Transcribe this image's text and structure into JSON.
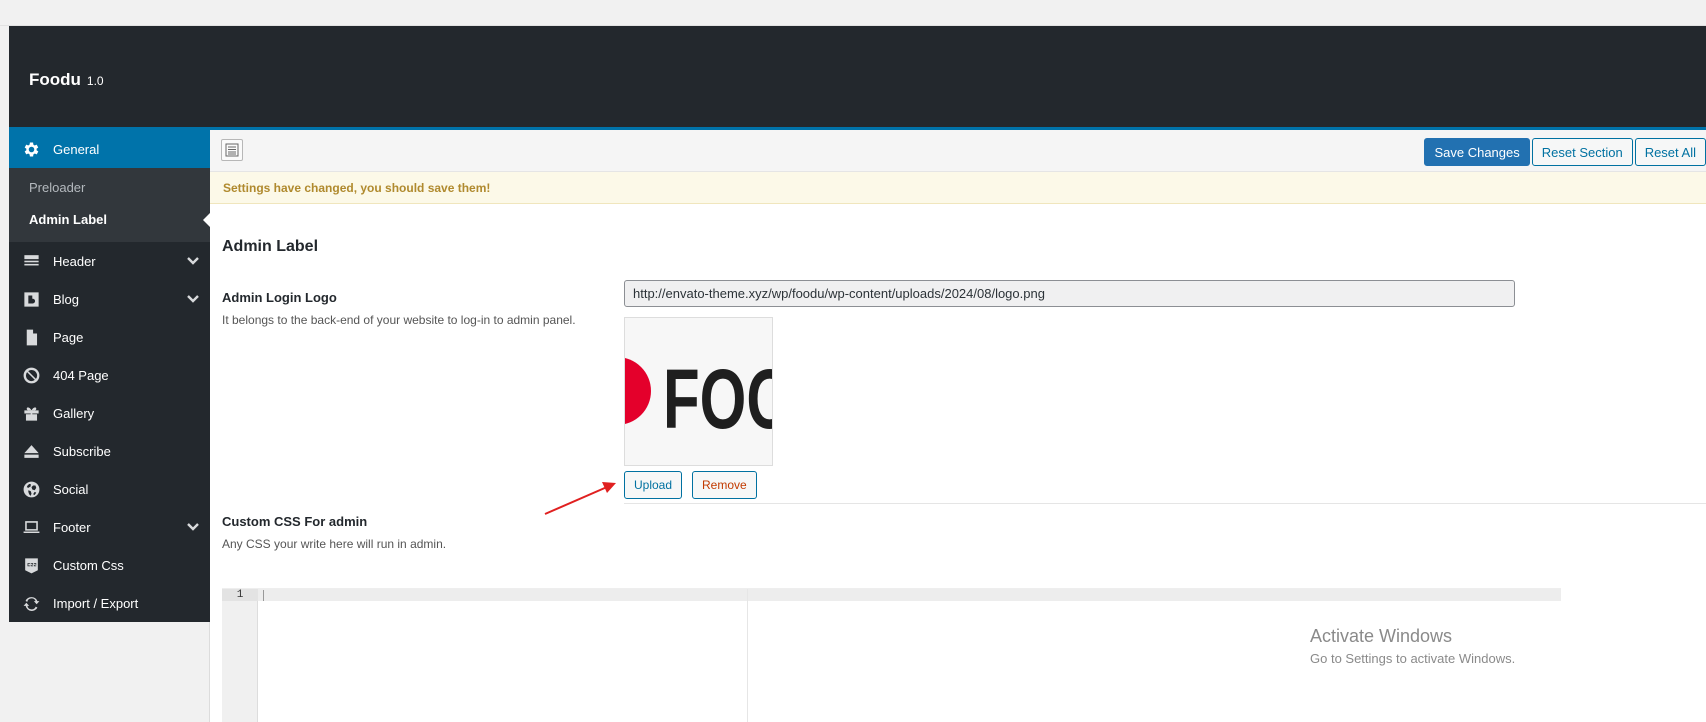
{
  "app": {
    "name": "Foodu",
    "version": "1.0"
  },
  "sidebar": {
    "items": [
      {
        "label": "General",
        "icon": "gear-icon",
        "active": true
      },
      {
        "label": "Header",
        "icon": "header-icon",
        "has_children": true
      },
      {
        "label": "Blog",
        "icon": "blog-icon",
        "has_children": true
      },
      {
        "label": "Page",
        "icon": "page-icon"
      },
      {
        "label": "404 Page",
        "icon": "ban-icon"
      },
      {
        "label": "Gallery",
        "icon": "gift-icon"
      },
      {
        "label": "Subscribe",
        "icon": "eject-icon"
      },
      {
        "label": "Social",
        "icon": "globe-icon"
      },
      {
        "label": "Footer",
        "icon": "laptop-icon",
        "has_children": true
      },
      {
        "label": "Custom Css",
        "icon": "css-icon"
      },
      {
        "label": "Import / Export",
        "icon": "refresh-icon"
      }
    ],
    "subitems": [
      {
        "label": "Preloader"
      },
      {
        "label": "Admin Label",
        "current": true
      }
    ]
  },
  "toolbar": {
    "save_label": "Save Changes",
    "reset_section_label": "Reset Section",
    "reset_all_label": "Reset All"
  },
  "notice": "Settings have changed, you should save them!",
  "section": {
    "title": "Admin Label",
    "fields": {
      "logo": {
        "label": "Admin Login Logo",
        "description": "It belongs to the back-end of your website to log-in to admin panel.",
        "value": "http://envato-theme.xyz/wp/foodu/wp-content/uploads/2024/08/logo.png",
        "preview_text": "FOO",
        "upload_label": "Upload",
        "remove_label": "Remove"
      },
      "css": {
        "label": "Custom CSS For admin",
        "description": "Any CSS your write here will run in admin.",
        "line_number": "1"
      }
    }
  },
  "watermark": {
    "title": "Activate Windows",
    "subtitle": "Go to Settings to activate Windows."
  },
  "colors": {
    "header_bg": "#23282d",
    "accent": "#0073aa",
    "logo_red": "#e4002b"
  }
}
